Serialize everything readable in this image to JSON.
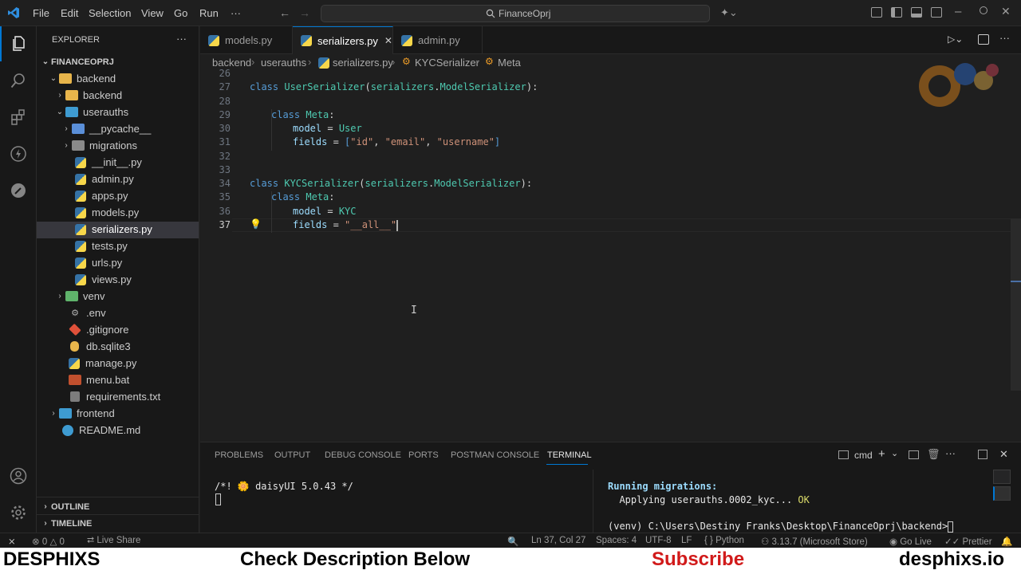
{
  "menu": [
    "File",
    "Edit",
    "Selection",
    "View",
    "Go",
    "Run",
    "···"
  ],
  "command_center": "FinanceOprj",
  "explorer": {
    "title": "EXPLORER",
    "more": "···",
    "root": "FINANCEOPRJ",
    "items": [
      {
        "label": "backend"
      },
      {
        "label": "backend"
      },
      {
        "label": "userauths"
      },
      {
        "label": "__pycache__"
      },
      {
        "label": "migrations"
      },
      {
        "label": "__init__.py"
      },
      {
        "label": "admin.py"
      },
      {
        "label": "apps.py"
      },
      {
        "label": "models.py"
      },
      {
        "label": "serializers.py"
      },
      {
        "label": "tests.py"
      },
      {
        "label": "urls.py"
      },
      {
        "label": "views.py"
      },
      {
        "label": "venv"
      },
      {
        "label": ".env"
      },
      {
        "label": ".gitignore"
      },
      {
        "label": "db.sqlite3"
      },
      {
        "label": "manage.py"
      },
      {
        "label": "menu.bat"
      },
      {
        "label": "requirements.txt"
      },
      {
        "label": "frontend"
      },
      {
        "label": "README.md"
      }
    ],
    "outline": "OUTLINE",
    "timeline": "TIMELINE"
  },
  "tabs": [
    {
      "label": "models.py"
    },
    {
      "label": "serializers.py"
    },
    {
      "label": "admin.py"
    }
  ],
  "breadcrumb": [
    "backend",
    "userauths",
    "serializers.py",
    "KYCSerializer",
    "Meta"
  ],
  "editor": {
    "line_numbers": [
      "26",
      "27",
      "28",
      "29",
      "30",
      "31",
      "32",
      "33",
      "34",
      "35",
      "36",
      "37"
    ],
    "code": {
      "l27": {
        "kw": "class",
        "name": "UserSerializer",
        "paren_open": "(",
        "base_mod": "serializers",
        "dot": ".",
        "base_cls": "ModelSerializer",
        "end": "):"
      },
      "l29": {
        "kw": "class",
        "name": "Meta",
        "end": ":"
      },
      "l30": {
        "var": "model",
        "eq": " = ",
        "val": "User"
      },
      "l31": {
        "var": "fields",
        "eq": " = ",
        "open": "[",
        "s1": "\"id\"",
        "c1": ", ",
        "s2": "\"email\"",
        "c2": ", ",
        "s3": "\"username\"",
        "close": "]"
      },
      "l34": {
        "kw": "class",
        "name": "KYCSerializer",
        "paren_open": "(",
        "base_mod": "serializers",
        "dot": ".",
        "base_cls": "ModelSerializer",
        "end": "):"
      },
      "l35": {
        "kw": "class",
        "name": "Meta",
        "end": ":"
      },
      "l36": {
        "var": "model",
        "eq": " = ",
        "val": "KYC"
      },
      "l37": {
        "var": "fields",
        "eq": " = ",
        "val": "\"__all__\""
      }
    }
  },
  "panel": {
    "tabs": [
      "PROBLEMS",
      "OUTPUT",
      "DEBUG CONSOLE",
      "PORTS",
      "POSTMAN CONSOLE",
      "TERMINAL"
    ],
    "shell": "cmd",
    "left_term": {
      "line1": "/*! 🌼 daisyUI 5.0.43 */"
    },
    "right_term": {
      "line1": "Running migrations:",
      "line2": "  Applying userauths.0002_kyc... ",
      "ok": "OK",
      "prompt": "(venv) C:\\Users\\Destiny Franks\\Desktop\\FinanceOprj\\backend>"
    }
  },
  "status": {
    "errors": "0",
    "warnings": "0",
    "live_share": "Live Share",
    "position": "Ln 37, Col 27",
    "spaces": "Spaces: 4",
    "encoding": "UTF-8",
    "eol": "LF",
    "language": "Python",
    "interpreter": "3.13.7 (Microsoft Store)",
    "go_live": "Go Live",
    "prettier": "Prettier"
  },
  "banner": {
    "left": "DESPHIXS",
    "center": "Check Description Below",
    "subscribe": "Subscribe",
    "right": "desphixs.io"
  },
  "colors": {
    "accent": "#0078d4",
    "keyword": "#569cd6",
    "class": "#4ec9b0",
    "variable": "#9cdcfe",
    "string": "#ce9178",
    "ok": "#f3f99d",
    "subscribe": "#d11a1a"
  }
}
